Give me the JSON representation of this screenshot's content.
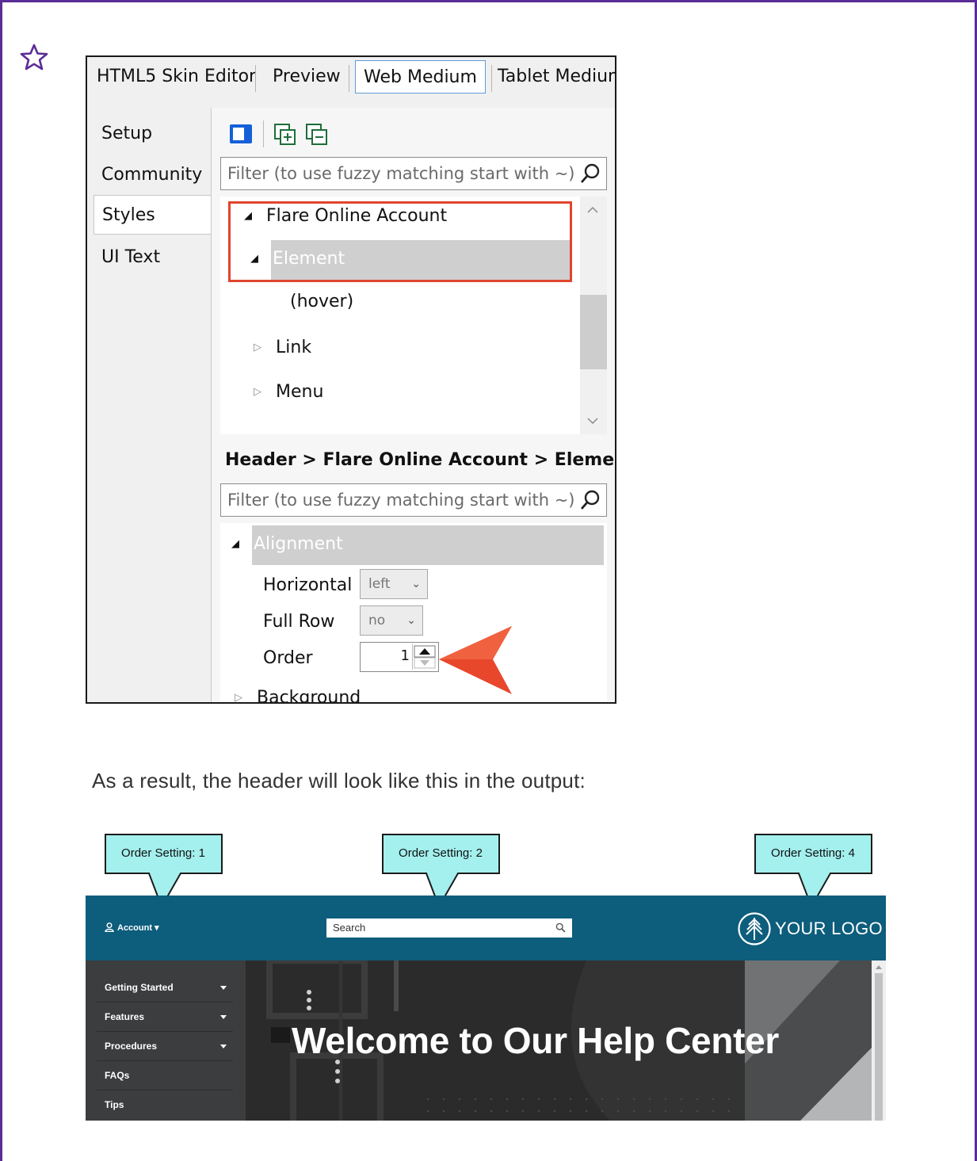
{
  "editor": {
    "tabs": [
      "HTML5 Skin Editor",
      "Preview",
      "Web Medium",
      "Tablet Medium"
    ],
    "active_tab": "Web Medium",
    "side_tabs": [
      "Setup",
      "Community",
      "Styles",
      "UI Text"
    ],
    "active_side_tab": "Styles",
    "toolbar_icons": [
      "panel-toggle-icon",
      "expand-all-icon",
      "collapse-all-icon"
    ],
    "filter_placeholder": "Filter (to use fuzzy matching start with ~)",
    "tree": [
      {
        "label": "Flare Online Account",
        "expanded": true
      },
      {
        "label": "Element",
        "expanded": true,
        "selected": true
      },
      {
        "label": "(hover)"
      },
      {
        "label": "Link",
        "expanded": false
      },
      {
        "label": "Menu",
        "expanded": false
      }
    ],
    "breadcrumb": "Header > Flare Online Account > Element",
    "properties_filter_placeholder": "Filter (to use fuzzy matching start with ~)",
    "category": "Alignment",
    "properties": {
      "horizontal_label": "Horizontal",
      "horizontal_value": "left",
      "full_row_label": "Full Row",
      "full_row_value": "no",
      "order_label": "Order",
      "order_value": "1"
    },
    "next_category": "Background"
  },
  "caption": "As a result, the header will look like this in the output:",
  "callouts": [
    "Order Setting: 1",
    "Order Setting: 2",
    "Order Setting: 4"
  ],
  "output": {
    "account_label": "Account ▾",
    "search_placeholder": "Search",
    "logo_text": "YOUR LOGO",
    "nav_items": [
      {
        "label": "Getting Started",
        "has_submenu": true
      },
      {
        "label": "Features",
        "has_submenu": true
      },
      {
        "label": "Procedures",
        "has_submenu": true
      },
      {
        "label": "FAQs",
        "has_submenu": false
      },
      {
        "label": "Tips",
        "has_submenu": false
      }
    ],
    "hero_title": "Welcome to Our Help Center"
  },
  "colors": {
    "frame_border": "#5b2d96",
    "highlight_red": "#e0452e",
    "header_teal": "#0d5d7c",
    "callout_fill": "#a3f0ee"
  }
}
